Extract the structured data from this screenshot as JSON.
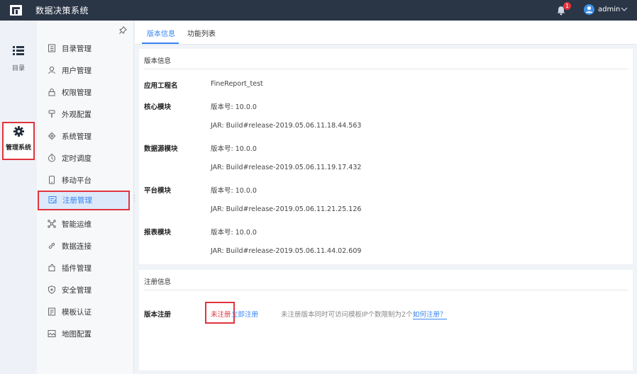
{
  "app": {
    "title": "数据决策系统",
    "notification_count": "1",
    "user": "admin"
  },
  "leftnav": {
    "directory_label": "目录",
    "management_label": "管理系统"
  },
  "submenu": {
    "items": [
      {
        "label": "目录管理",
        "icon": "catalog-icon"
      },
      {
        "label": "用户管理",
        "icon": "user-icon"
      },
      {
        "label": "权限管理",
        "icon": "lock-icon"
      },
      {
        "label": "外观配置",
        "icon": "brush-icon"
      },
      {
        "label": "系统管理",
        "icon": "gear-icon"
      },
      {
        "label": "定时调度",
        "icon": "timer-icon"
      },
      {
        "label": "移动平台",
        "icon": "mobile-icon"
      },
      {
        "label": "注册管理",
        "icon": "register-icon"
      },
      {
        "label": "智能运维",
        "icon": "ops-icon"
      },
      {
        "label": "数据连接",
        "icon": "link-icon"
      },
      {
        "label": "插件管理",
        "icon": "plugin-icon"
      },
      {
        "label": "安全管理",
        "icon": "shield-icon"
      },
      {
        "label": "模板认证",
        "icon": "template-icon"
      },
      {
        "label": "地图配置",
        "icon": "map-icon"
      }
    ],
    "active_index": 7
  },
  "tabs": [
    {
      "label": "版本信息"
    },
    {
      "label": "功能列表"
    }
  ],
  "version_card": {
    "title": "版本信息",
    "rows": [
      {
        "label": "应用工程名",
        "value": "FineReport_test"
      },
      {
        "label": "核心模块",
        "value": "版本号: 10.0.0"
      },
      {
        "label": "",
        "value": "JAR: Build#release-2019.05.06.11.18.44.563"
      },
      {
        "label": "数据源模块",
        "value": "版本号: 10.0.0"
      },
      {
        "label": "",
        "value": "JAR: Build#release-2019.05.06.11.19.17.432"
      },
      {
        "label": "平台模块",
        "value": "版本号: 10.0.0"
      },
      {
        "label": "",
        "value": "JAR: Build#release-2019.05.06.11.21.25.126"
      },
      {
        "label": "报表模块",
        "value": "版本号: 10.0.0"
      },
      {
        "label": "",
        "value": "JAR: Build#release-2019.05.06.11.44.02.609"
      }
    ]
  },
  "register_card": {
    "title": "注册信息",
    "label": "版本注册",
    "status": "未注册",
    "register_link": "立即注册",
    "hint": "未注册版本同时可访问模板IP个数限制为2个！",
    "how_link": "如何注册？"
  },
  "colors": {
    "topbar": "#2a3546",
    "accent": "#3685f2",
    "highlight": "#e0343d"
  }
}
